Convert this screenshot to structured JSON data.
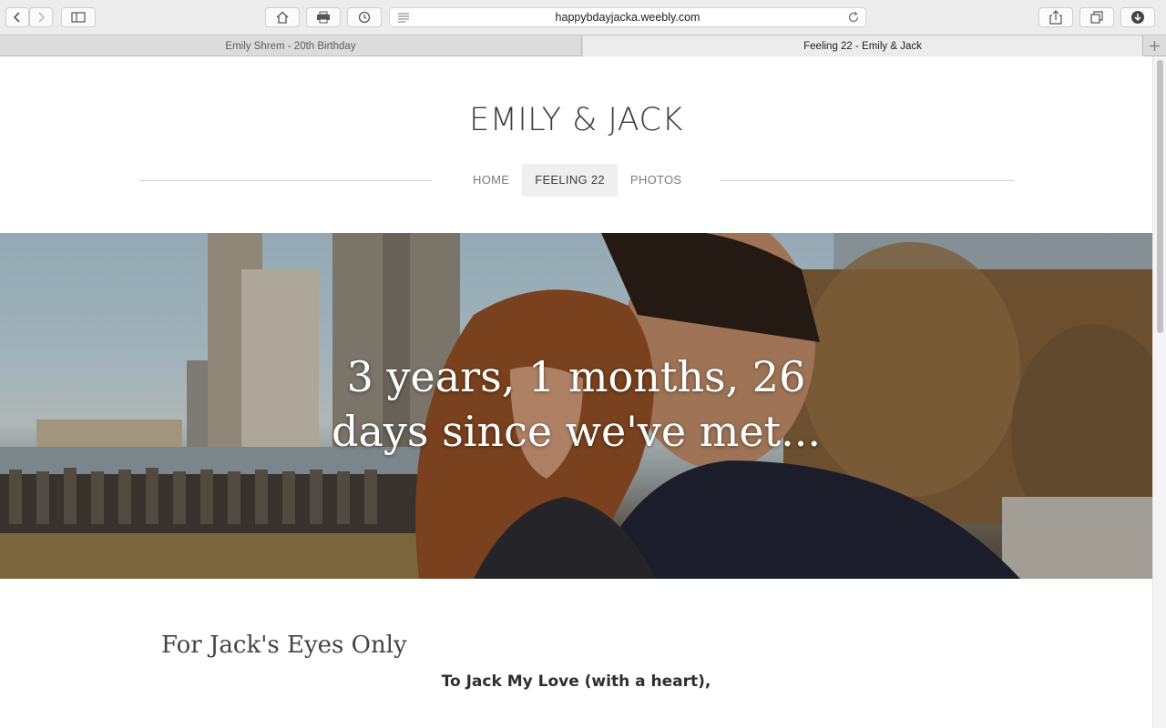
{
  "browser": {
    "url": "happybdayjacka.weebly.com",
    "tabs": [
      {
        "label": "Emily Shrem - 20th Birthday",
        "active": false
      },
      {
        "label": "Feeling 22 - Emily & Jack",
        "active": true
      }
    ]
  },
  "site": {
    "title": "EMILY & JACK",
    "nav": [
      {
        "label": "HOME",
        "active": false
      },
      {
        "label": "FEELING 22",
        "active": true
      },
      {
        "label": "PHOTOS",
        "active": false
      }
    ]
  },
  "hero": {
    "line1": "3 years, 1 months, 26",
    "line2": "days since we've met..."
  },
  "content": {
    "heading": "For Jack's Eyes Only",
    "greeting": "To Jack My Love (with a heart),"
  },
  "colors": {
    "chrome": "#ececec",
    "nav_active_bg": "#efefef",
    "text": "#333333"
  }
}
